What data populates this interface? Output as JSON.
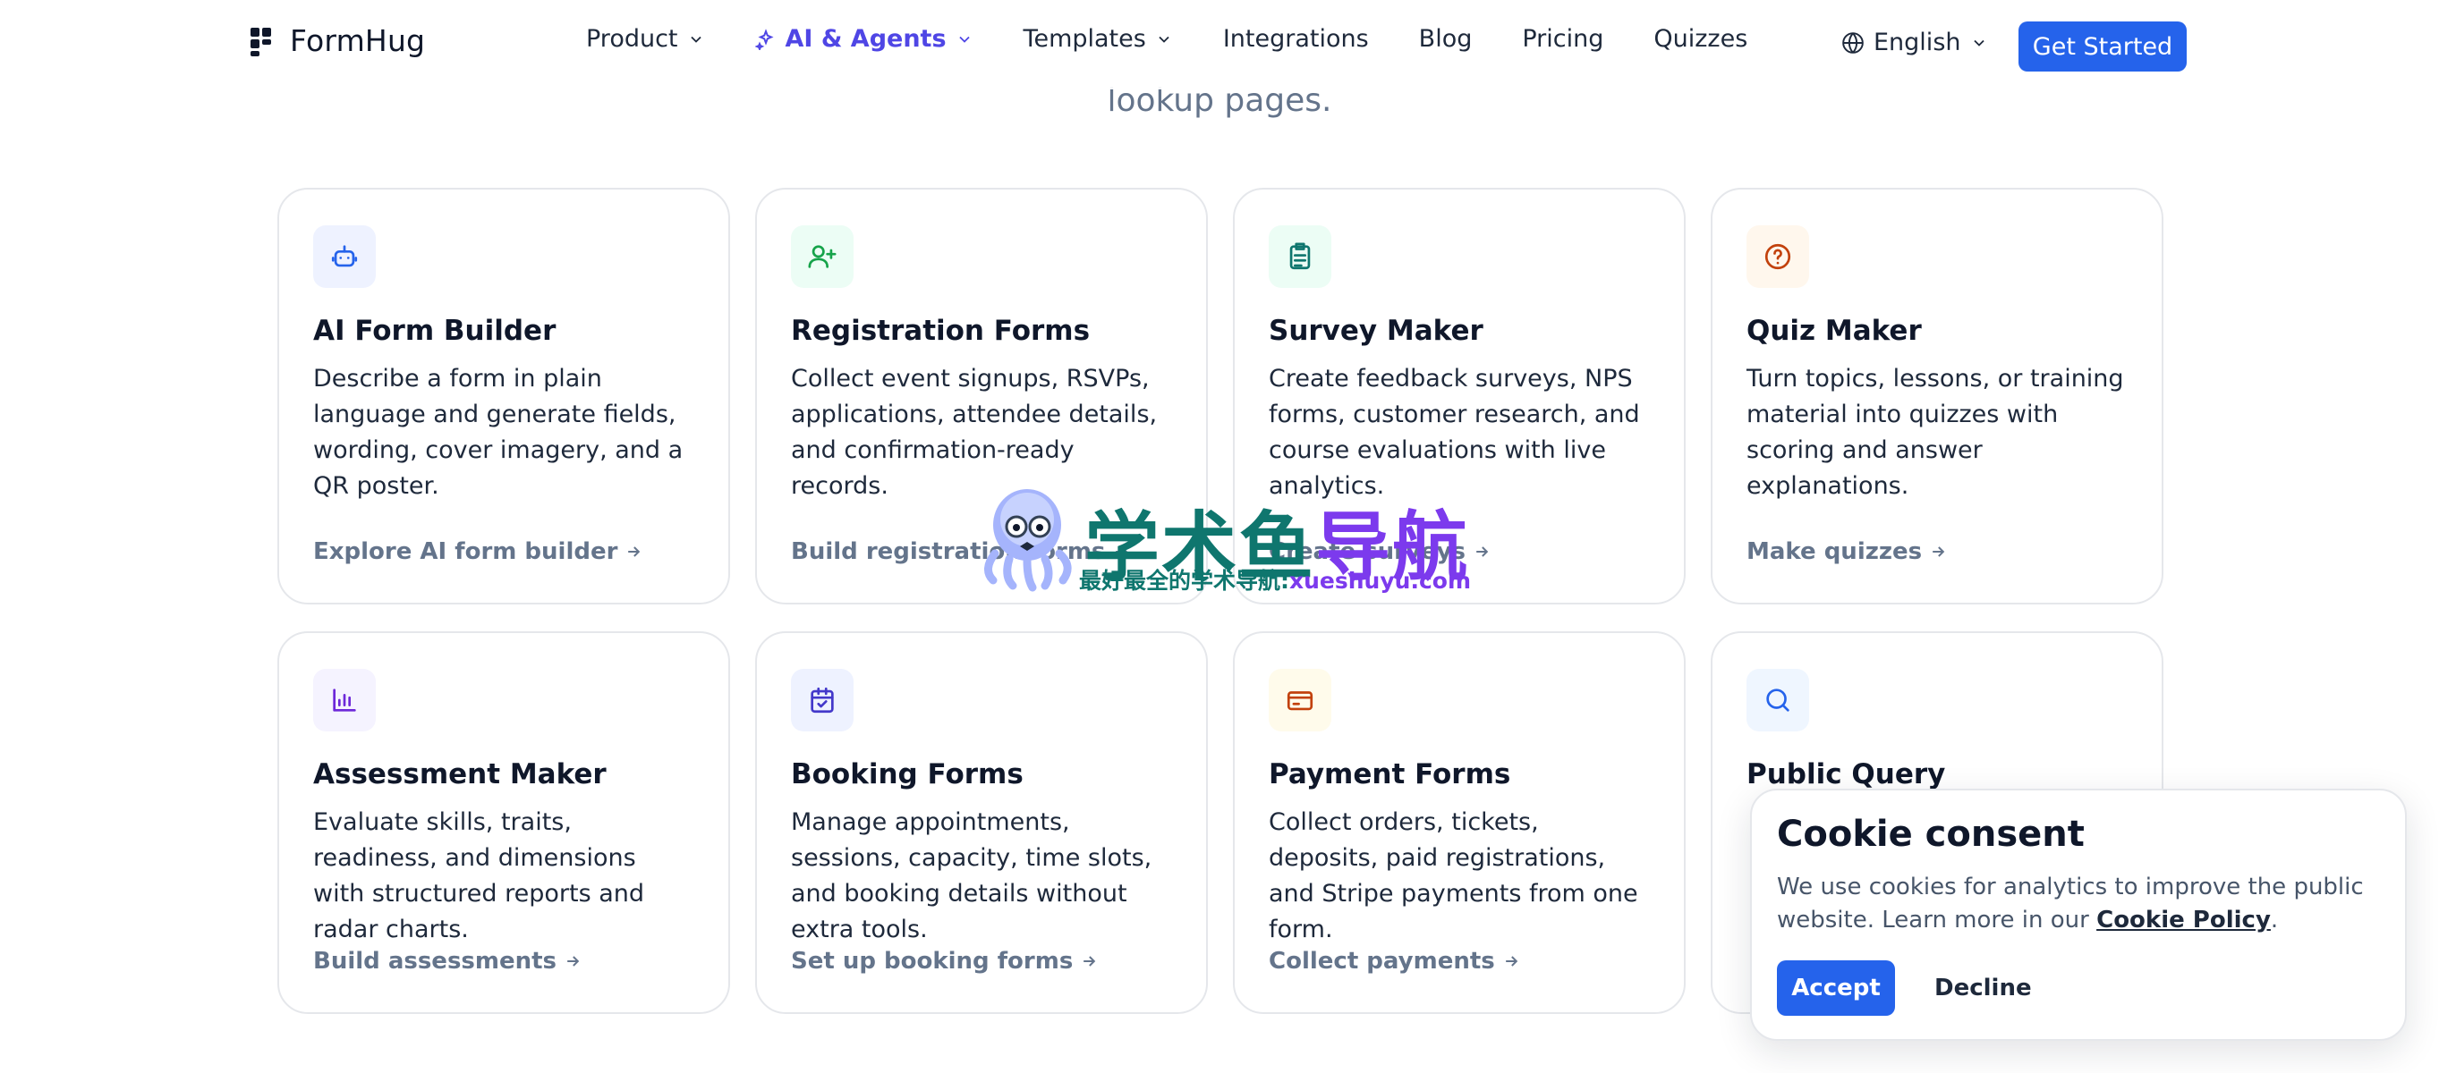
{
  "hero": {
    "subtitle_tail": "lookup pages."
  },
  "header": {
    "brand": "FormHug",
    "nav": [
      {
        "label": "Product",
        "has_menu": true
      },
      {
        "label": "AI & Agents",
        "has_menu": true,
        "active": true
      },
      {
        "label": "Templates",
        "has_menu": true
      },
      {
        "label": "Integrations",
        "has_menu": false
      },
      {
        "label": "Blog",
        "has_menu": false
      },
      {
        "label": "Pricing",
        "has_menu": false
      },
      {
        "label": "Quizzes",
        "has_menu": false
      }
    ],
    "language": "English",
    "cta": "Get Started"
  },
  "cards": [
    {
      "icon": "robot-icon",
      "icon_color": "#2563eb",
      "icon_bg": "#eef2ff",
      "title": "AI Form Builder",
      "description": "Describe a form in plain language and generate fields, wording, cover imagery, and a QR poster.",
      "link": "Explore AI form builder"
    },
    {
      "icon": "user-plus-icon",
      "icon_color": "#16a34a",
      "icon_bg": "#ecfdf5",
      "title": "Registration Forms",
      "description": "Collect event signups, RSVPs, applications, attendee details, and confirmation-ready records.",
      "link": "Build registration forms"
    },
    {
      "icon": "clipboard-icon",
      "icon_color": "#0f766e",
      "icon_bg": "#ecfdf5",
      "title": "Survey Maker",
      "description": "Create feedback surveys, NPS forms, customer research, and course evaluations with live analytics.",
      "link": "Create surveys"
    },
    {
      "icon": "question-circle-icon",
      "icon_color": "#c2410c",
      "icon_bg": "#fff7ed",
      "title": "Quiz Maker",
      "description": "Turn topics, lessons, or training material into quizzes with scoring and answer explanations.",
      "link": "Make quizzes"
    },
    {
      "icon": "bar-chart-icon",
      "icon_color": "#6d28d9",
      "icon_bg": "#f5f3ff",
      "title": "Assessment Maker",
      "description": "Evaluate skills, traits, readiness, and dimensions with structured reports and radar charts.",
      "link": "Build assessments"
    },
    {
      "icon": "calendar-check-icon",
      "icon_color": "#4338ca",
      "icon_bg": "#eef2ff",
      "title": "Booking Forms",
      "description": "Manage appointments, sessions, capacity, time slots, and booking details without extra tools.",
      "link": "Set up booking forms"
    },
    {
      "icon": "credit-card-icon",
      "icon_color": "#c2410c",
      "icon_bg": "#fffbeb",
      "title": "Payment Forms",
      "description": "Collect orders, tickets, deposits, paid registrations, and Stripe payments from one form.",
      "link": "Collect payments"
    },
    {
      "icon": "search-icon",
      "icon_color": "#2563eb",
      "icon_bg": "#eff6ff",
      "title": "Public Query",
      "description": "",
      "link": ""
    }
  ],
  "watermark": {
    "title_a": "学术鱼",
    "title_b": "导航",
    "subtitle_a": "最好最全的学术导航:",
    "subtitle_b": "xueshuyu.com"
  },
  "cookie": {
    "title": "Cookie consent",
    "text": "We use cookies for analytics to improve the public website. Learn more in our",
    "link": "Cookie Policy",
    "period": ".",
    "accept": "Accept",
    "decline": "Decline"
  },
  "colors": {
    "primary": "#2563eb",
    "accent_nav": "#4f46e5",
    "muted": "#64748b"
  }
}
